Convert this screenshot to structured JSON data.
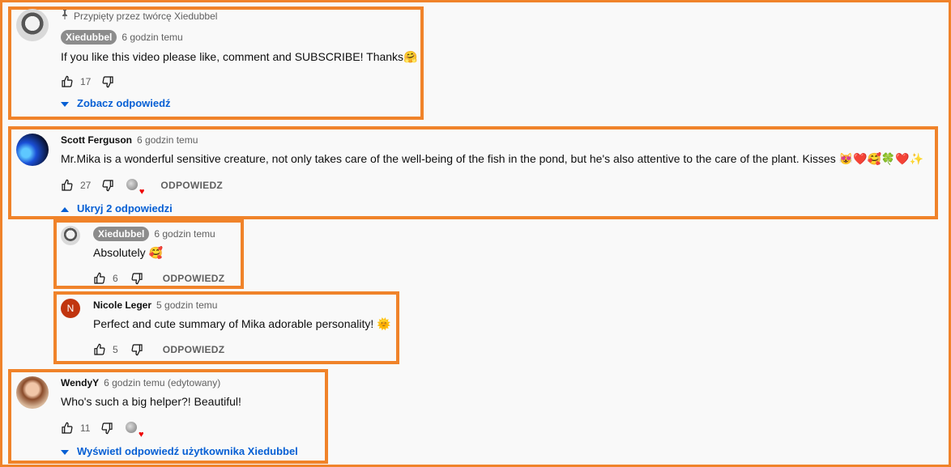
{
  "colors": {
    "highlight": "#f0832a",
    "link": "#065fd4",
    "muted": "#606060",
    "heart": "#e00000"
  },
  "comments": [
    {
      "pinned_label": "Przypięty przez twórcę Xiedubbel",
      "author": "Xiedubbel",
      "time": "6 godzin temu",
      "text": "If you like this video please like, comment and SUBSCRIBE! Thanks🤗",
      "likes": "17",
      "replies_toggle": "Zobacz odpowiedź"
    },
    {
      "author": "Scott Ferguson",
      "time": "6 godzin temu",
      "text": "Mr.Mika is a wonderful sensitive creature, not only takes care of the well-being of the fish in the pond, but he's also attentive to the care of the plant. Kisses 😻❤️🥰🍀❤️✨",
      "likes": "27",
      "reply_label": "ODPOWIEDZ",
      "replies_toggle": "Ukryj 2 odpowiedzi"
    },
    {
      "author": "WendyY",
      "time": "6 godzin temu (edytowany)",
      "text": "Who's such a big helper?!  Beautiful!",
      "likes": "11",
      "replies_toggle": "Wyświetl odpowiedź użytkownika Xiedubbel"
    }
  ],
  "replies": [
    {
      "author": "Xiedubbel",
      "time": "6 godzin temu",
      "text": "Absolutely 🥰",
      "likes": "6",
      "reply_label": "ODPOWIEDZ"
    },
    {
      "author": "Nicole Leger",
      "avatar_letter": "N",
      "time": "5 godzin temu",
      "text": "Perfect and cute summary of Mika adorable personality! 🌞",
      "likes": "5",
      "reply_label": "ODPOWIEDZ"
    }
  ]
}
